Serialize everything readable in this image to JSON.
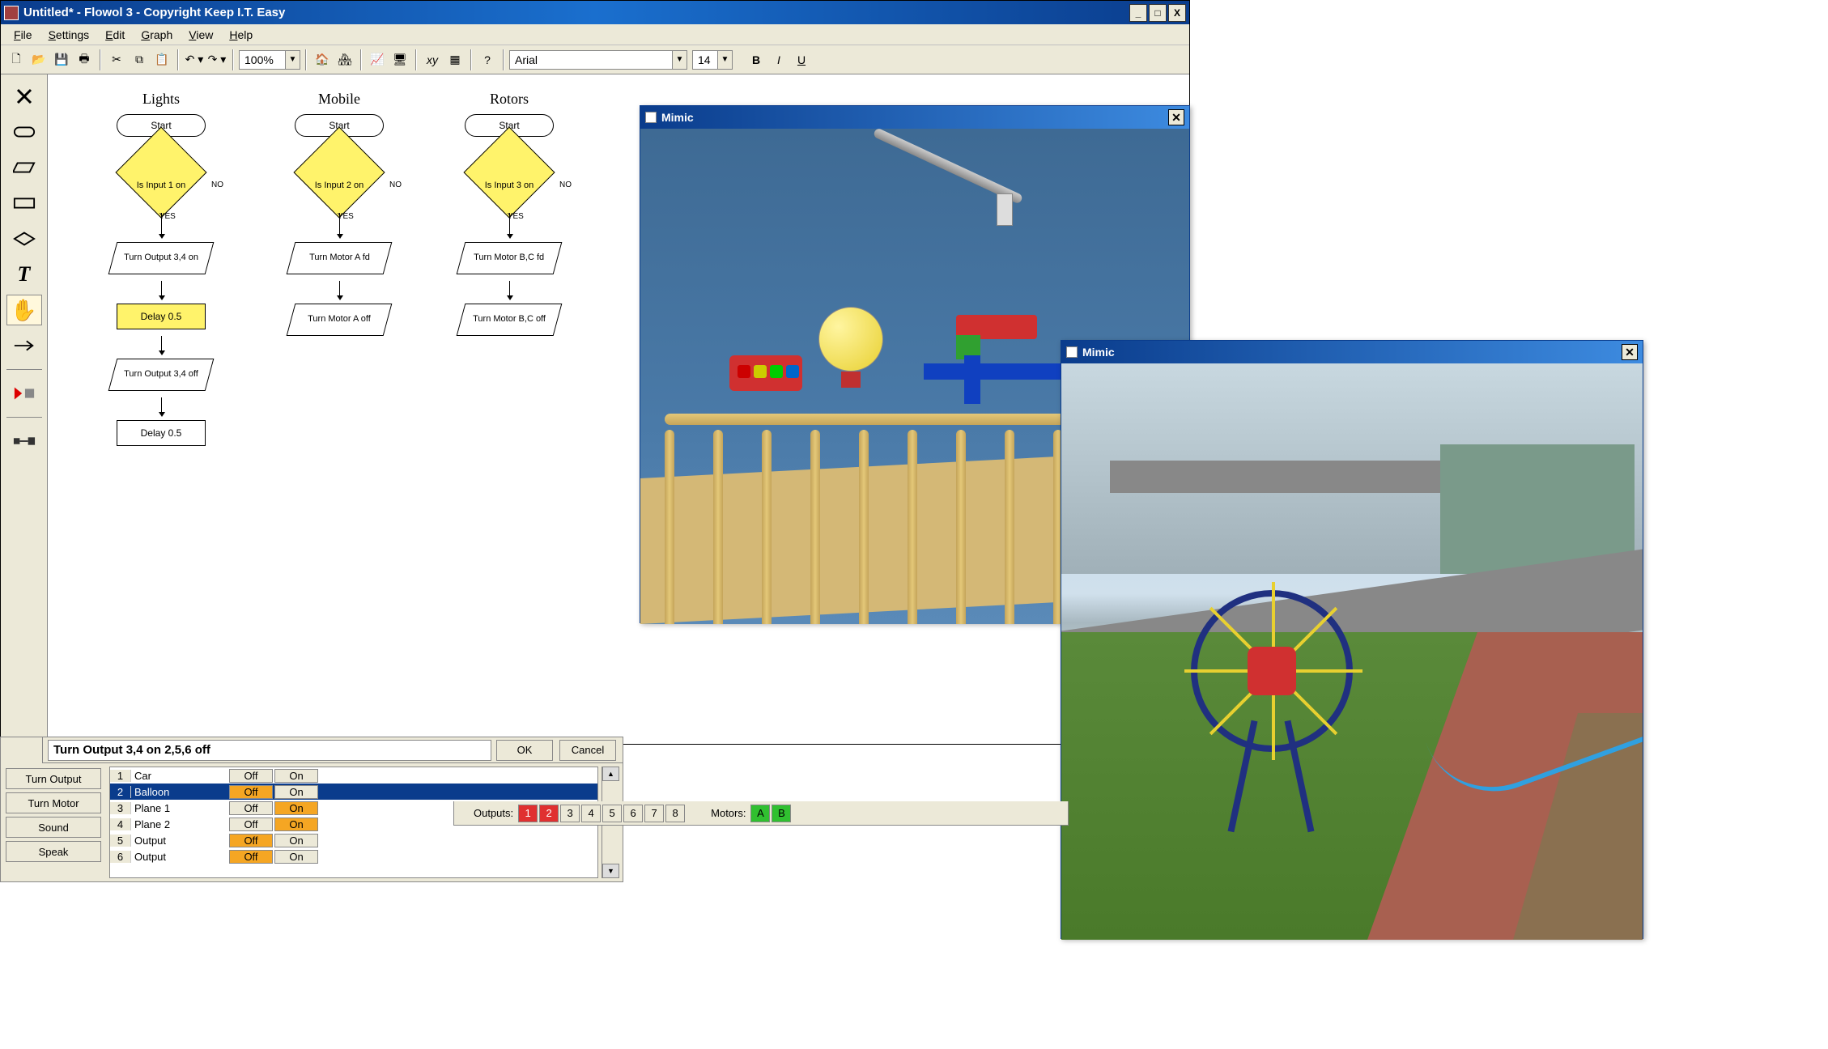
{
  "window": {
    "title": "Untitled* - Flowol 3 - Copyright Keep I.T. Easy",
    "controls": {
      "min": "_",
      "max": "□",
      "close": "X"
    }
  },
  "menu": [
    "File",
    "Settings",
    "Edit",
    "Graph",
    "View",
    "Help"
  ],
  "toolbar": {
    "zoom": "100%",
    "font": "Arial",
    "font_size": "14",
    "bold": "B",
    "italic": "I",
    "underline": "U"
  },
  "palette": {
    "items": [
      "delete",
      "terminator",
      "parallelogram",
      "rectangle",
      "diamond",
      "text",
      "hand",
      "arrow"
    ],
    "special": [
      "run-stop",
      "connect"
    ]
  },
  "flowcharts": [
    {
      "title": "Lights",
      "start": "Start",
      "decision": "Is Input 1 on",
      "yes": "YES",
      "no": "NO",
      "steps": [
        "Turn Output 3,4 on",
        "Delay 0.5",
        "Turn Output 3,4 off",
        "Delay 0.5"
      ]
    },
    {
      "title": "Mobile",
      "start": "Start",
      "decision": "Is Input 2 on",
      "yes": "YES",
      "no": "NO",
      "steps": [
        "Turn Motor A fd",
        "Turn Motor A off"
      ]
    },
    {
      "title": "Rotors",
      "start": "Start",
      "decision": "Is Input 3 on",
      "yes": "YES",
      "no": "NO",
      "steps": [
        "Turn Motor B,C fd",
        "Turn Motor B,C off"
      ]
    }
  ],
  "mimic1": {
    "title": "Mimic"
  },
  "mimic2": {
    "title": "Mimic"
  },
  "dialog": {
    "command": "Turn Output 3,4 on 2,5,6 off",
    "ok": "OK",
    "cancel": "Cancel",
    "side": [
      "Turn Output",
      "Turn Motor",
      "Sound",
      "Speak"
    ],
    "rows": [
      {
        "n": "1",
        "name": "Car",
        "off": "Off",
        "on": "On",
        "off_sel": false,
        "on_sel": false
      },
      {
        "n": "2",
        "name": "Balloon",
        "off": "Off",
        "on": "On",
        "off_sel": true,
        "on_sel": false,
        "selected": true
      },
      {
        "n": "3",
        "name": "Plane 1",
        "off": "Off",
        "on": "On",
        "off_sel": false,
        "on_sel": true
      },
      {
        "n": "4",
        "name": "Plane 2",
        "off": "Off",
        "on": "On",
        "off_sel": false,
        "on_sel": true
      },
      {
        "n": "5",
        "name": "Output",
        "off": "Off",
        "on": "On",
        "off_sel": true,
        "on_sel": false
      },
      {
        "n": "6",
        "name": "Output",
        "off": "Off",
        "on": "On",
        "off_sel": true,
        "on_sel": false
      }
    ]
  },
  "status": {
    "outputs_label": "Outputs:",
    "outputs": [
      "1",
      "2",
      "3",
      "4",
      "5",
      "6",
      "7",
      "8"
    ],
    "outputs_active": [
      0,
      1
    ],
    "motors_label": "Motors:",
    "motors": [
      "A",
      "B"
    ]
  }
}
